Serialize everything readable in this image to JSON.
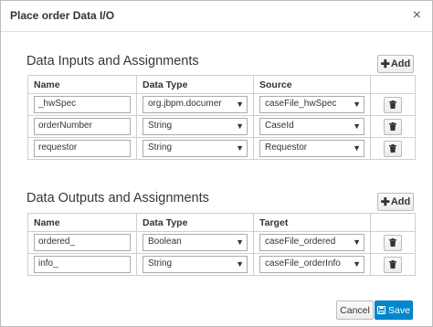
{
  "dialog": {
    "title": "Place order Data I/O",
    "close_glyph": "×"
  },
  "inputs": {
    "heading": "Data Inputs and Assignments",
    "add_label": "Add",
    "columns": [
      "Name",
      "Data Type",
      "Source"
    ],
    "rows": [
      {
        "name": "_hwSpec",
        "type": "org.jbpm.documer",
        "source": "caseFile_hwSpec"
      },
      {
        "name": "orderNumber",
        "type": "String",
        "source": "CaseId"
      },
      {
        "name": "requestor",
        "type": "String",
        "source": "Requestor"
      }
    ]
  },
  "outputs": {
    "heading": "Data Outputs and Assignments",
    "add_label": "Add",
    "columns": [
      "Name",
      "Data Type",
      "Target"
    ],
    "rows": [
      {
        "name": "ordered_",
        "type": "Boolean",
        "source": "caseFile_ordered"
      },
      {
        "name": "info_",
        "type": "String",
        "source": "caseFile_orderInfo"
      }
    ]
  },
  "footer": {
    "cancel_label": "Cancel",
    "save_label": "Save"
  },
  "icons": {
    "close": "close-icon",
    "add": "plus-icon",
    "dropdown": "caret-down-icon",
    "delete": "trash-icon",
    "save": "floppy-disk-icon"
  },
  "colors": {
    "primary": "#0088ce",
    "border": "#cfcfcf"
  }
}
